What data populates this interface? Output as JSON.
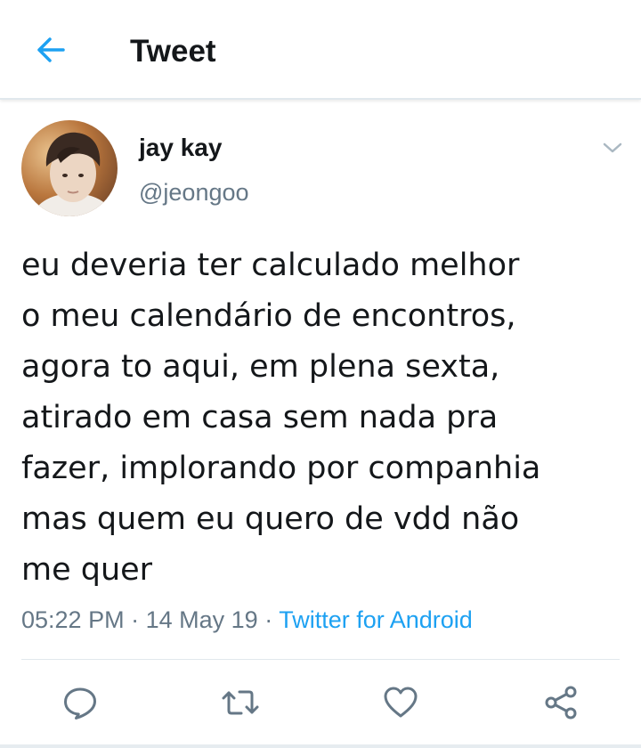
{
  "header": {
    "back_icon": "arrow-left-icon",
    "title": "Tweet"
  },
  "tweet": {
    "author": {
      "display_name": "jay kay",
      "handle": "@jeongoo",
      "avatar": "profile-photo"
    },
    "more_icon": "chevron-down-icon",
    "text_lines": [
      "eu deveria ter calculado melhor",
      "o meu calendário de encontros,",
      "agora to aqui, em plena sexta,",
      "atirado em casa sem nada pra",
      "fazer, implorando por companhia",
      "mas quem eu quero de vdd não",
      "me quer"
    ],
    "time": "05:22 PM",
    "date": "14 May 19",
    "separator": "·",
    "source": "Twitter for Android"
  },
  "actions": {
    "reply_icon": "reply-icon",
    "retweet_icon": "retweet-icon",
    "like_icon": "heart-icon",
    "share_icon": "share-icon"
  },
  "colors": {
    "accent": "#1da1f2",
    "text": "#14171a",
    "secondary": "#657786",
    "border": "#e1e8ed"
  }
}
